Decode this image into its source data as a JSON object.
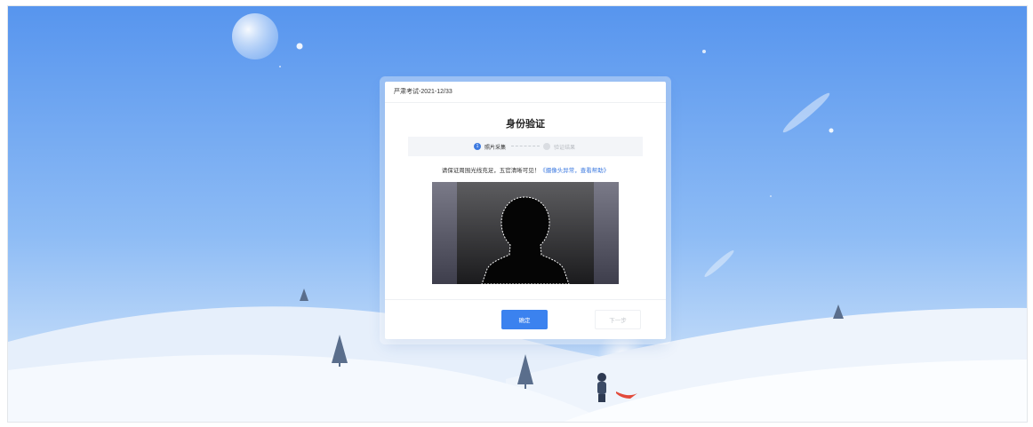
{
  "exam": {
    "title": "严肃考试-2021-12/33"
  },
  "dialog": {
    "heading": "身份验证"
  },
  "steps": [
    {
      "index": "1",
      "label": "照片采集",
      "active": true
    },
    {
      "index": "2",
      "label": "验证结果",
      "active": false
    }
  ],
  "notice": {
    "text": "请保证周围光线充足，五官清晰可见！",
    "link": "《摄像头异常，查看帮助》"
  },
  "buttons": {
    "confirm": "确定",
    "next": "下一步"
  },
  "colors": {
    "accent": "#3b82ef",
    "sky_top": "#5b9af0",
    "snow": "#f4f8fd"
  },
  "icons": {
    "camera_placeholder": "head-silhouette-icon"
  }
}
